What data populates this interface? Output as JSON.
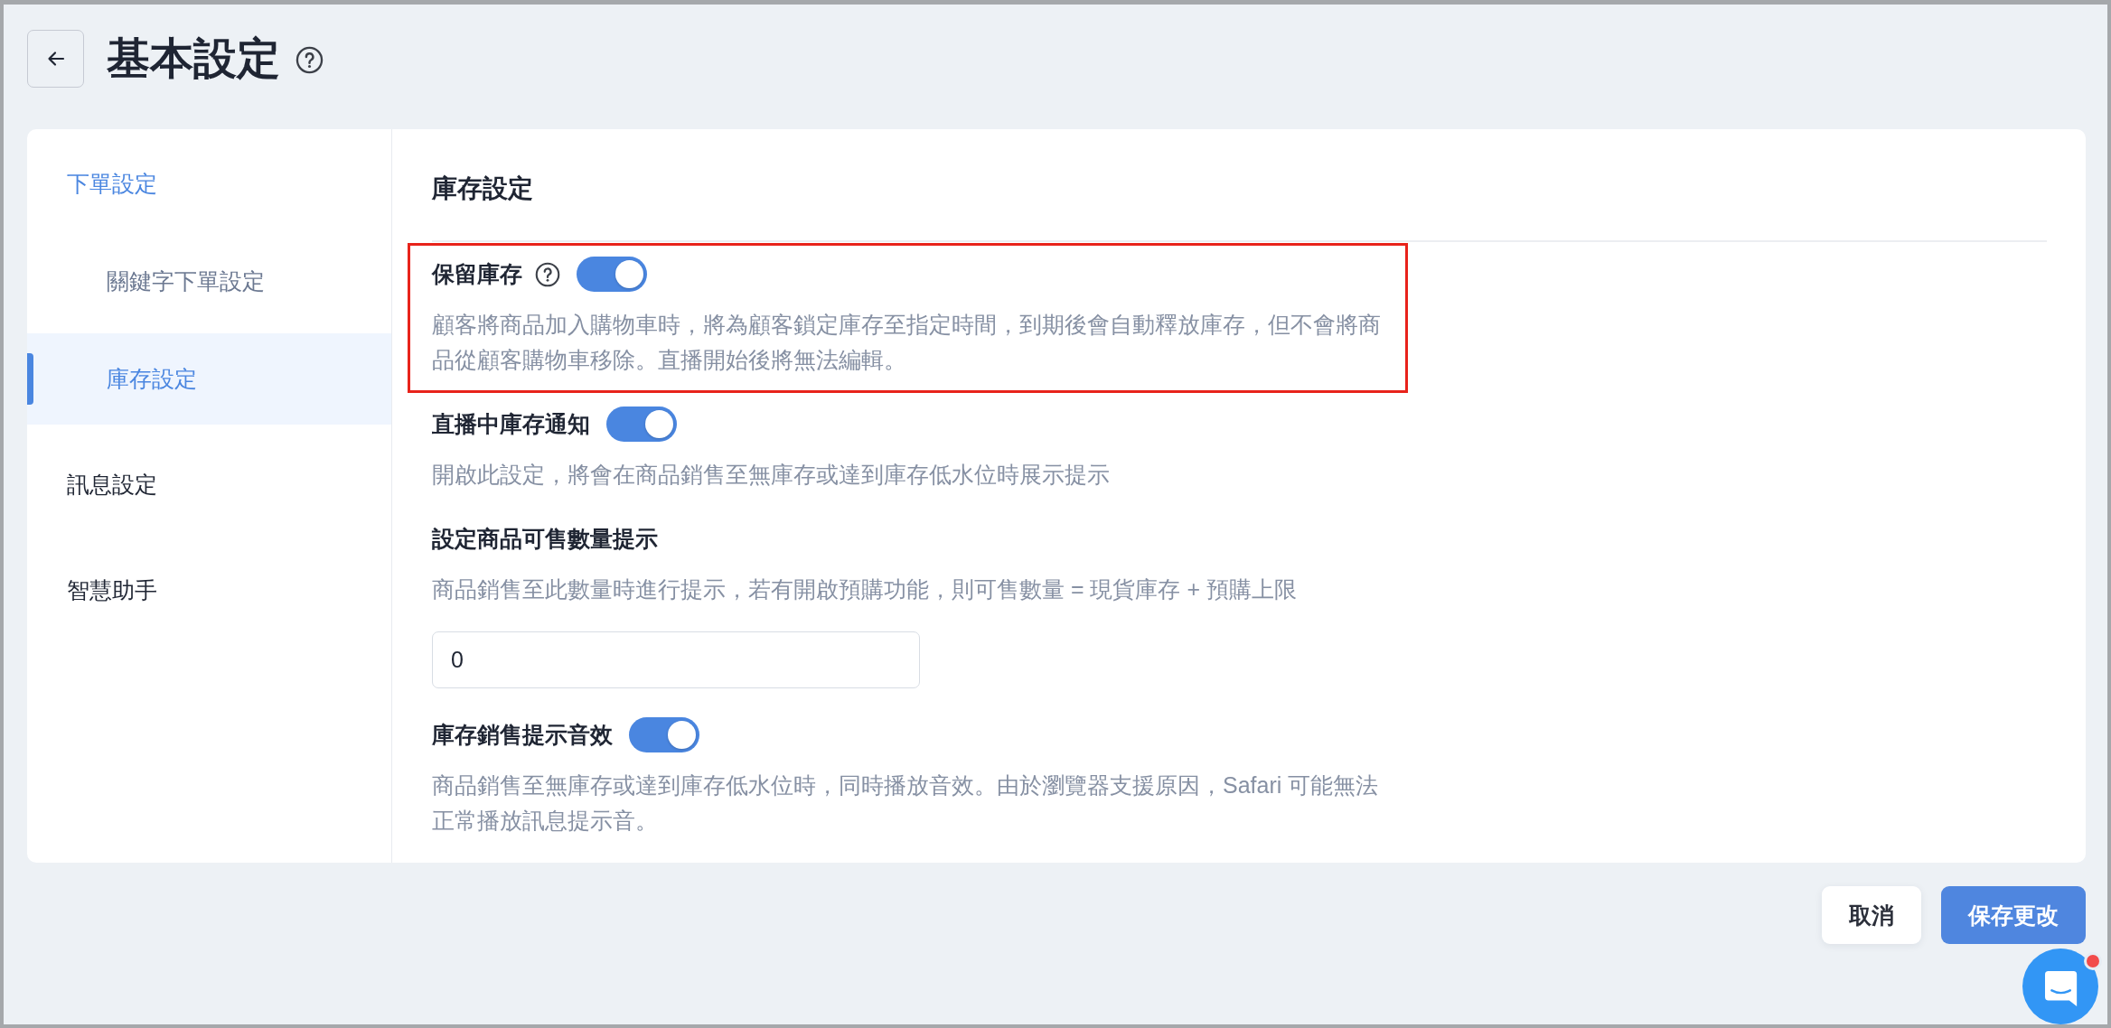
{
  "header": {
    "title": "基本設定"
  },
  "sidebar": {
    "items": [
      {
        "label": "下單設定",
        "selected": false,
        "children": [
          {
            "label": "關鍵字下單設定",
            "selected": false
          },
          {
            "label": "庫存設定",
            "selected": true
          }
        ]
      },
      {
        "label": "訊息設定",
        "selected": false
      },
      {
        "label": "智慧助手",
        "selected": false
      }
    ]
  },
  "section": {
    "title": "庫存設定",
    "settings": [
      {
        "kind": "toggle",
        "label": "保留庫存",
        "help_icon": true,
        "on": true,
        "highlighted": true,
        "description": "顧客將商品加入購物車時，將為顧客鎖定庫存至指定時間，到期後會自動釋放庫存，但不會將商品從顧客購物車移除。直播開始後將無法編輯。"
      },
      {
        "kind": "toggle",
        "label": "直播中庫存通知",
        "help_icon": false,
        "on": true,
        "highlighted": false,
        "description": "開啟此設定，將會在商品銷售至無庫存或達到庫存低水位時展示提示"
      },
      {
        "kind": "number",
        "label": "設定商品可售數量提示",
        "help_icon": false,
        "highlighted": false,
        "description": "商品銷售至此數量時進行提示，若有開啟預購功能，則可售數量 = 現貨庫存 + 預購上限",
        "value": "0"
      },
      {
        "kind": "toggle",
        "label": "庫存銷售提示音效",
        "help_icon": false,
        "on": true,
        "highlighted": false,
        "description": "商品銷售至無庫存或達到庫存低水位時，同時播放音效。由於瀏覽器支援原因，Safari 可能無法正常播放訊息提示音。"
      }
    ]
  },
  "footer": {
    "buttons": [
      {
        "label": "取消",
        "kind": "secondary"
      },
      {
        "label": "保存更改",
        "kind": "primary"
      }
    ]
  },
  "chat_widget": {
    "unread": true
  }
}
